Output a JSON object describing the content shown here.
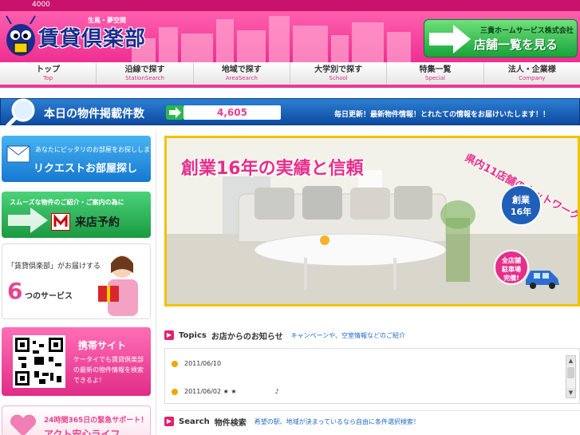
{
  "top_strip": {
    "number": "4000"
  },
  "header": {
    "logo_small": "生馬・夢空間",
    "logo_main": "賃貸倶楽部",
    "store_button": {
      "line1": "三貴ホームサービス株式会社",
      "line2": "店舗一覧を見る"
    }
  },
  "nav": {
    "items": [
      {
        "label": "トップ",
        "sub": "Top"
      },
      {
        "label": "沿線で探す",
        "sub": "StationSearch"
      },
      {
        "label": "地域で探す",
        "sub": "AreaSearch"
      },
      {
        "label": "大学別で探す",
        "sub": "School"
      },
      {
        "label": "特集一覧",
        "sub": "Special"
      },
      {
        "label": "法人・企業様",
        "sub": "Company"
      }
    ]
  },
  "count_bar": {
    "label": "本日の物件掲載件数",
    "count": "4,605",
    "message": "毎日更新！最新物件情報！とれたての情報をお届けいたします！！"
  },
  "banners": {
    "request": {
      "small": "あなたにピッタリのお部屋をお探しします",
      "big": "リクエストお部屋探し"
    },
    "visit": {
      "small": "スムーズな物件のご紹介・ご案内の為に",
      "big": "来店予約"
    },
    "services": {
      "line1": "「賃貸倶楽部」がお届けする",
      "number": "6",
      "line2": "つのサービス"
    },
    "mobile": {
      "title": "携帯サイト",
      "desc": "ケータイでも賃貸倶楽部の最新の物件情報を検索できるよ！"
    },
    "support": {
      "line1": "24時間365日の緊急サポート！",
      "line2": "アクト安心ライフ"
    }
  },
  "hero": {
    "title": "創業16年の実績と信頼",
    "arc_text": "県内11店舗のネットワーク",
    "badge": {
      "line1": "創業",
      "line2": "16年"
    },
    "parking": {
      "line1": "全店舗",
      "line2": "駐車場",
      "line3": "完備!"
    }
  },
  "topics": {
    "en": "Topics",
    "jp": "お店からのお知らせ",
    "sub": "キャンペーンや、空室情報などのご紹介",
    "rows": [
      {
        "text": "2011/06/10"
      },
      {
        "text": "2011/06/02 ★ ★　　　　　　♪"
      }
    ]
  },
  "search": {
    "en": "Search",
    "jp": "物件検索",
    "sub": "希望の駅、地域が決まっているなら自由に条件選択検索！"
  }
}
